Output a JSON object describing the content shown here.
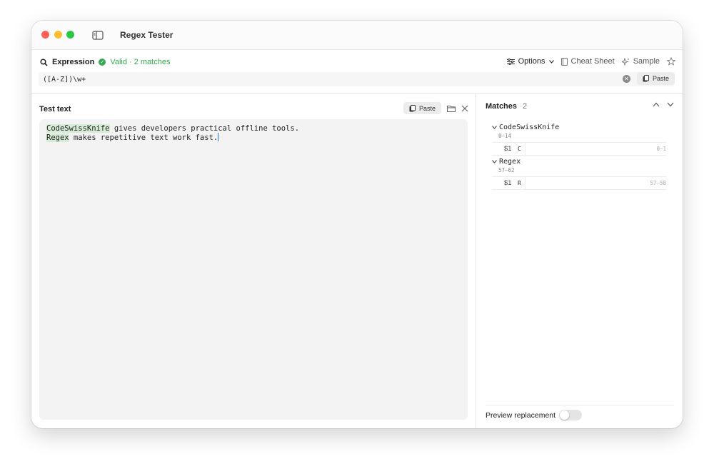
{
  "window": {
    "title": "Regex Tester"
  },
  "expression": {
    "label": "Expression",
    "status": "Valid · 2 matches",
    "value": "([A-Z])\\w+",
    "toolbar": {
      "options": "Options",
      "cheat_sheet": "Cheat Sheet",
      "sample": "Sample"
    },
    "paste_label": "Paste"
  },
  "test_text": {
    "title": "Test text",
    "paste_label": "Paste",
    "lines": [
      {
        "highlight": "CodeSwissKnife",
        "rest": " gives developers practical offline tools."
      },
      {
        "highlight": "Regex",
        "rest": " makes repetitive text work fast."
      }
    ]
  },
  "matches": {
    "title": "Matches",
    "count": "2",
    "items": [
      {
        "text": "CodeSwissKnife",
        "range": "0–14",
        "group_label": "$1",
        "group_value": "C",
        "group_range": "0–1"
      },
      {
        "text": "Regex",
        "range": "57–62",
        "group_label": "$1",
        "group_value": "R",
        "group_range": "57–58"
      }
    ],
    "preview_label": "Preview replacement",
    "preview_enabled": false
  },
  "colors": {
    "accent_green": "#34a853",
    "highlight": "#d7ecd7",
    "caret": "#2b6fe0"
  }
}
